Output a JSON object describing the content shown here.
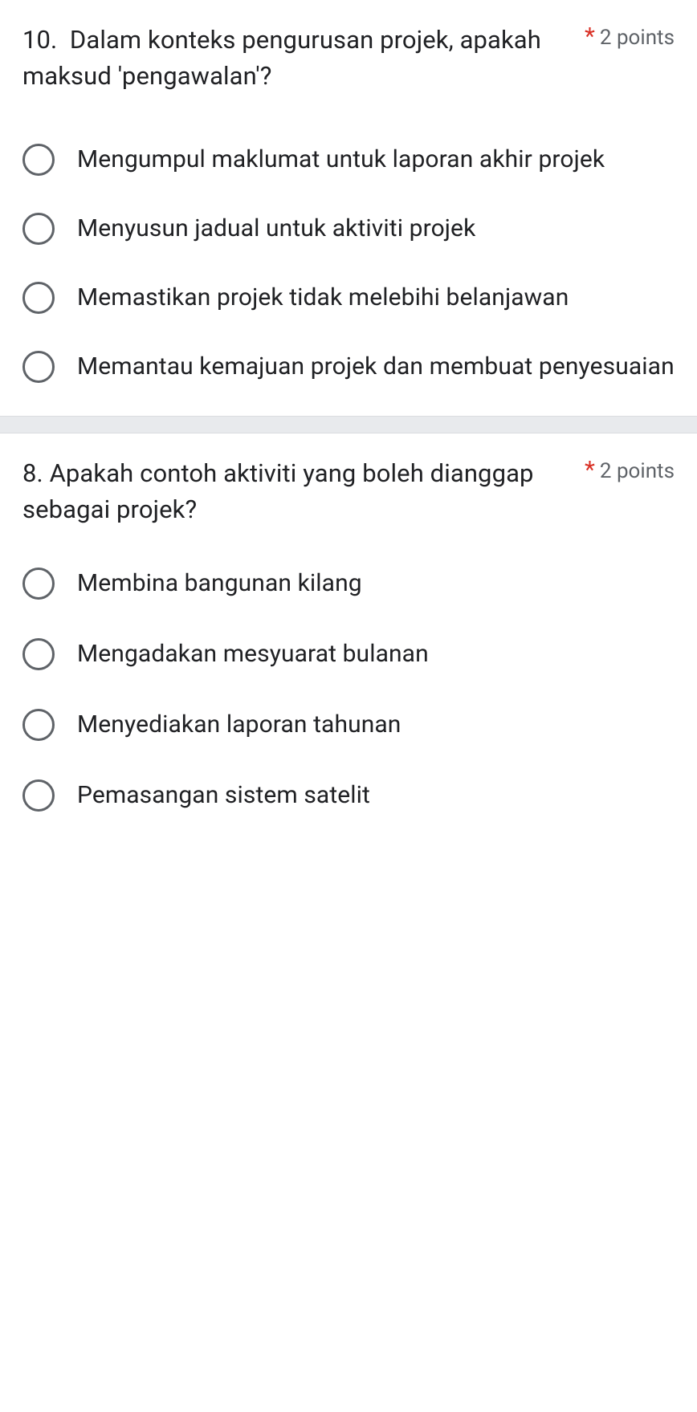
{
  "questions": [
    {
      "number": "10.",
      "text": "Dalam konteks pengurusan projek, apakah maksud 'pengawalan'?",
      "required_mark": "*",
      "points": "2 points",
      "options": [
        "Mengumpul maklumat untuk laporan akhir projek",
        "Menyusun jadual untuk aktiviti projek",
        "Memastikan projek tidak melebihi belanjawan",
        "Memantau kemajuan projek dan membuat penyesuaian"
      ]
    },
    {
      "number": "8.",
      "text": "Apakah contoh aktiviti yang boleh dianggap sebagai projek?",
      "required_mark": "*",
      "points": "2 points",
      "options": [
        "Membina bangunan kilang",
        "Mengadakan mesyuarat bulanan",
        "Menyediakan laporan tahunan",
        "Pemasangan sistem satelit"
      ]
    }
  ]
}
